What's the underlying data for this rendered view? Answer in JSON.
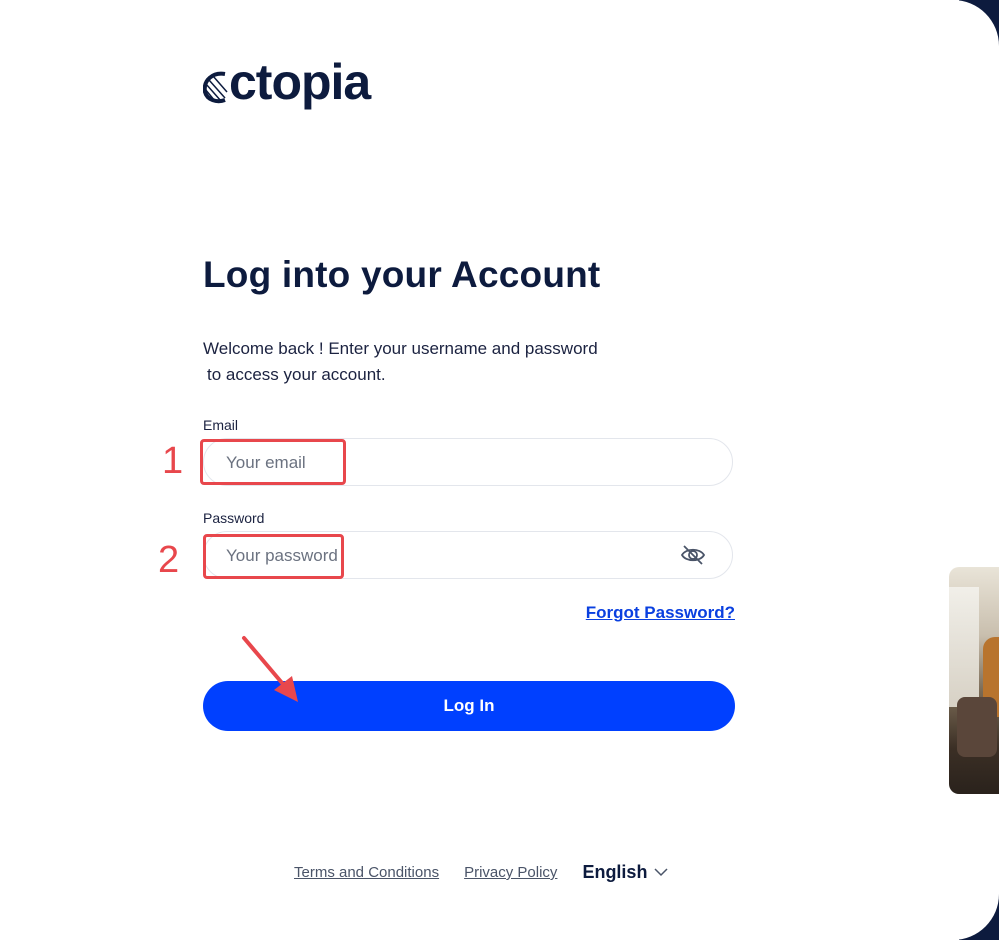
{
  "brand": {
    "name": "ctopia"
  },
  "login": {
    "title": "Log into your Account",
    "subtitle_line1": "Welcome back ! Enter your username and password",
    "subtitle_line2": "to access your account.",
    "email_label": "Email",
    "email_placeholder": "Your email",
    "email_value": "",
    "password_label": "Password",
    "password_placeholder": "Your password",
    "password_value": "",
    "forgot_label": "Forgot Password?",
    "submit_label": "Log In"
  },
  "annotations": {
    "email_marker": "1",
    "password_marker": "2",
    "color": "#e8474c"
  },
  "footer": {
    "terms_label": "Terms and Conditions",
    "privacy_label": "Privacy Policy",
    "language": "English"
  },
  "icons": {
    "password_toggle": "eye-off-icon",
    "language_dropdown": "chevron-down-icon",
    "annotation_arrow": "arrow-icon"
  },
  "colors": {
    "primary": "#0040ff",
    "text_dark": "#0d1b3e",
    "link": "#0a40e0"
  }
}
